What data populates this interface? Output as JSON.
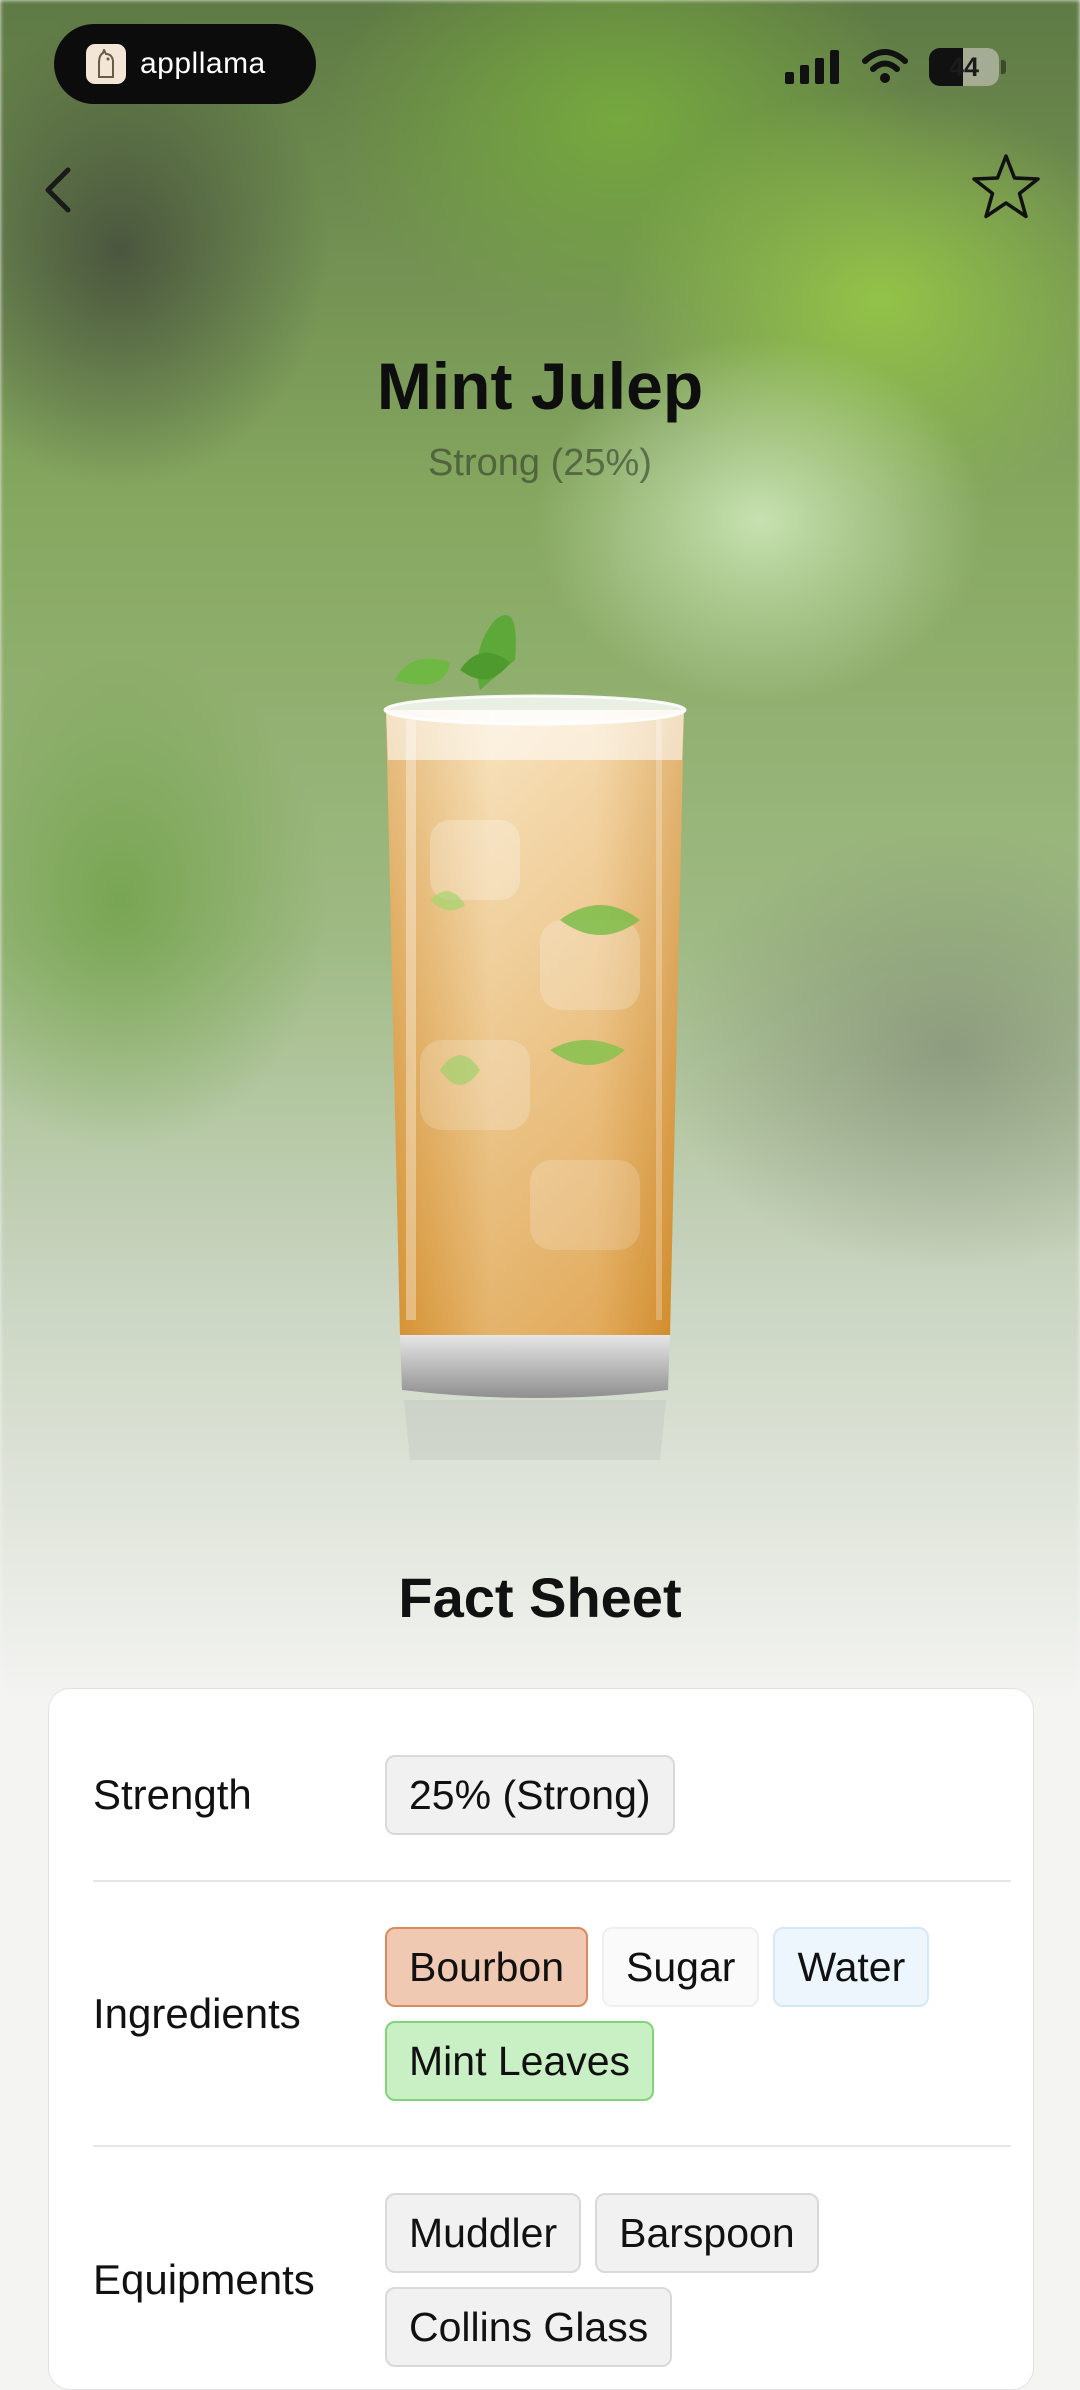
{
  "status_bar": {
    "brand": "appllama",
    "battery": "44"
  },
  "nav": {
    "back_icon": "chevron-left-icon",
    "favorite_icon": "star-outline-icon"
  },
  "drink": {
    "name": "Mint Julep",
    "strength_summary": "Strong (25%)"
  },
  "fact_sheet": {
    "title": "Fact Sheet",
    "strength": {
      "label": "Strength",
      "chips": [
        "25% (Strong)"
      ]
    },
    "ingredients": {
      "label": "Ingredients",
      "chips": [
        "Bourbon",
        "Sugar",
        "Water",
        "Mint Leaves"
      ]
    },
    "equipments": {
      "label": "Equipments",
      "chips": [
        "Muddler",
        "Barspoon",
        "Collins Glass"
      ]
    }
  },
  "colors": {
    "bourbon_chip": "#f0c9b2",
    "water_chip": "#eef6fd",
    "mint_chip": "#c9efc4"
  }
}
